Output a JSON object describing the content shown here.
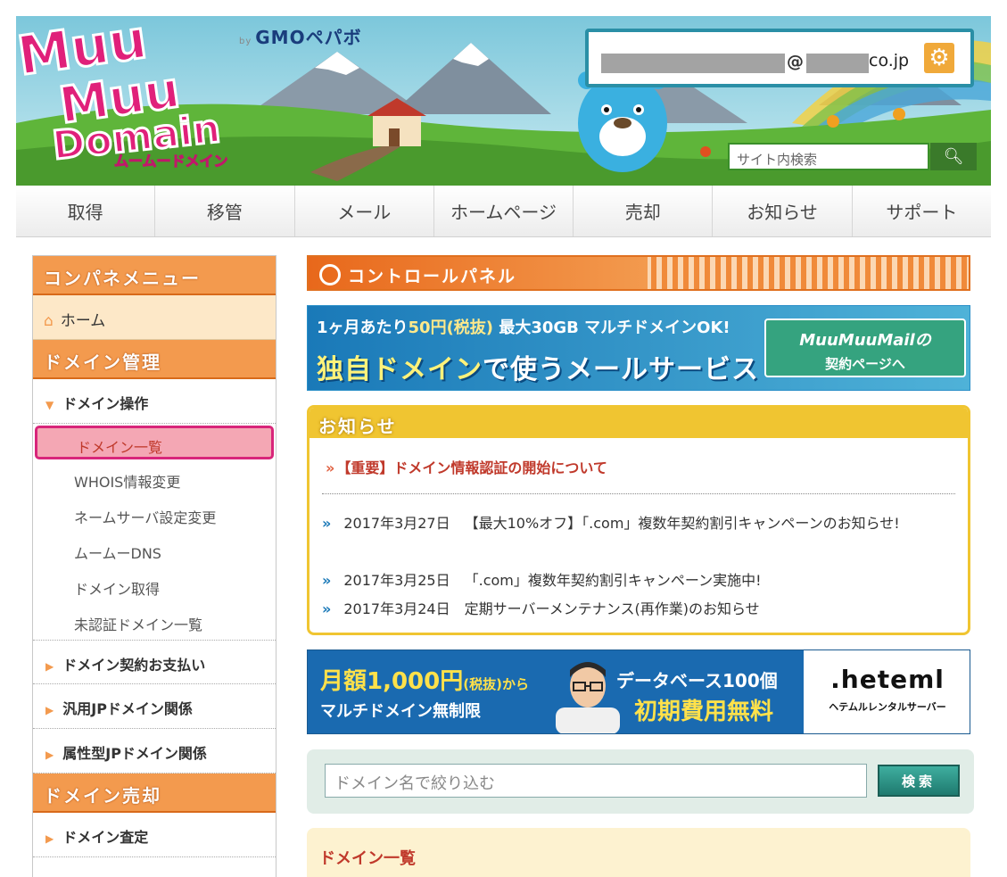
{
  "header": {
    "gmo_by": "by",
    "gmo_brand": "GMOペパボ",
    "account_at": "@",
    "account_domain": "co.jp",
    "search_placeholder": "サイト内検索"
  },
  "nav": [
    "取得",
    "移管",
    "メール",
    "ホームページ",
    "売却",
    "お知らせ",
    "サポート"
  ],
  "sidebar": {
    "title": "コンパネメニュー",
    "home": "ホーム",
    "section_domain": "ドメイン管理",
    "domain_ops": "ドメイン操作",
    "subitems": [
      "ドメイン一覧",
      "WHOIS情報変更",
      "ネームサーバ設定変更",
      "ムームーDNS",
      "ドメイン取得",
      "未認証ドメイン一覧"
    ],
    "cats": [
      "ドメイン契約お支払い",
      "汎用JPドメイン関係",
      "属性型JPドメイン関係"
    ],
    "section_sale": "ドメイン売却",
    "sale_cat": "ドメイン査定"
  },
  "main": {
    "title": "コントロールパネル",
    "banner1": {
      "line1_pre": "1ヶ月あたり",
      "line1_price": "50円(税抜)",
      "line1_post": "最大30GB マルチドメインOK!",
      "line2_pre": "独自ドメイン",
      "line2_post": "で使うメールサービス",
      "cta_brand": "MuuMuuMailの",
      "cta_text": "契約ページへ"
    },
    "news": {
      "title": "お知らせ",
      "important": "【重要】ドメイン情報認証の開始について",
      "marker": "»",
      "items": [
        {
          "date": "2017年3月27日",
          "text": "【最大10%オフ】「.com」複数年契約割引キャンペーンのお知らせ!"
        },
        {
          "date": "2017年3月25日",
          "text": "「.com」複数年契約割引キャンペーン実施中!"
        },
        {
          "date": "2017年3月24日",
          "text": "定期サーバーメンテナンス(再作業)のお知らせ"
        }
      ]
    },
    "banner2": {
      "price": "月額1,000円",
      "price_note": "(税抜)から",
      "sub": "マルチドメイン無制限",
      "db": "データベース100個",
      "free": "初期費用無料",
      "brand": ".heteml",
      "brand_sub": "ヘテムルレンタルサーバー"
    },
    "filter": {
      "placeholder": "ドメイン名で絞り込む",
      "button": "検索"
    },
    "list_title": "ドメイン一覧"
  }
}
